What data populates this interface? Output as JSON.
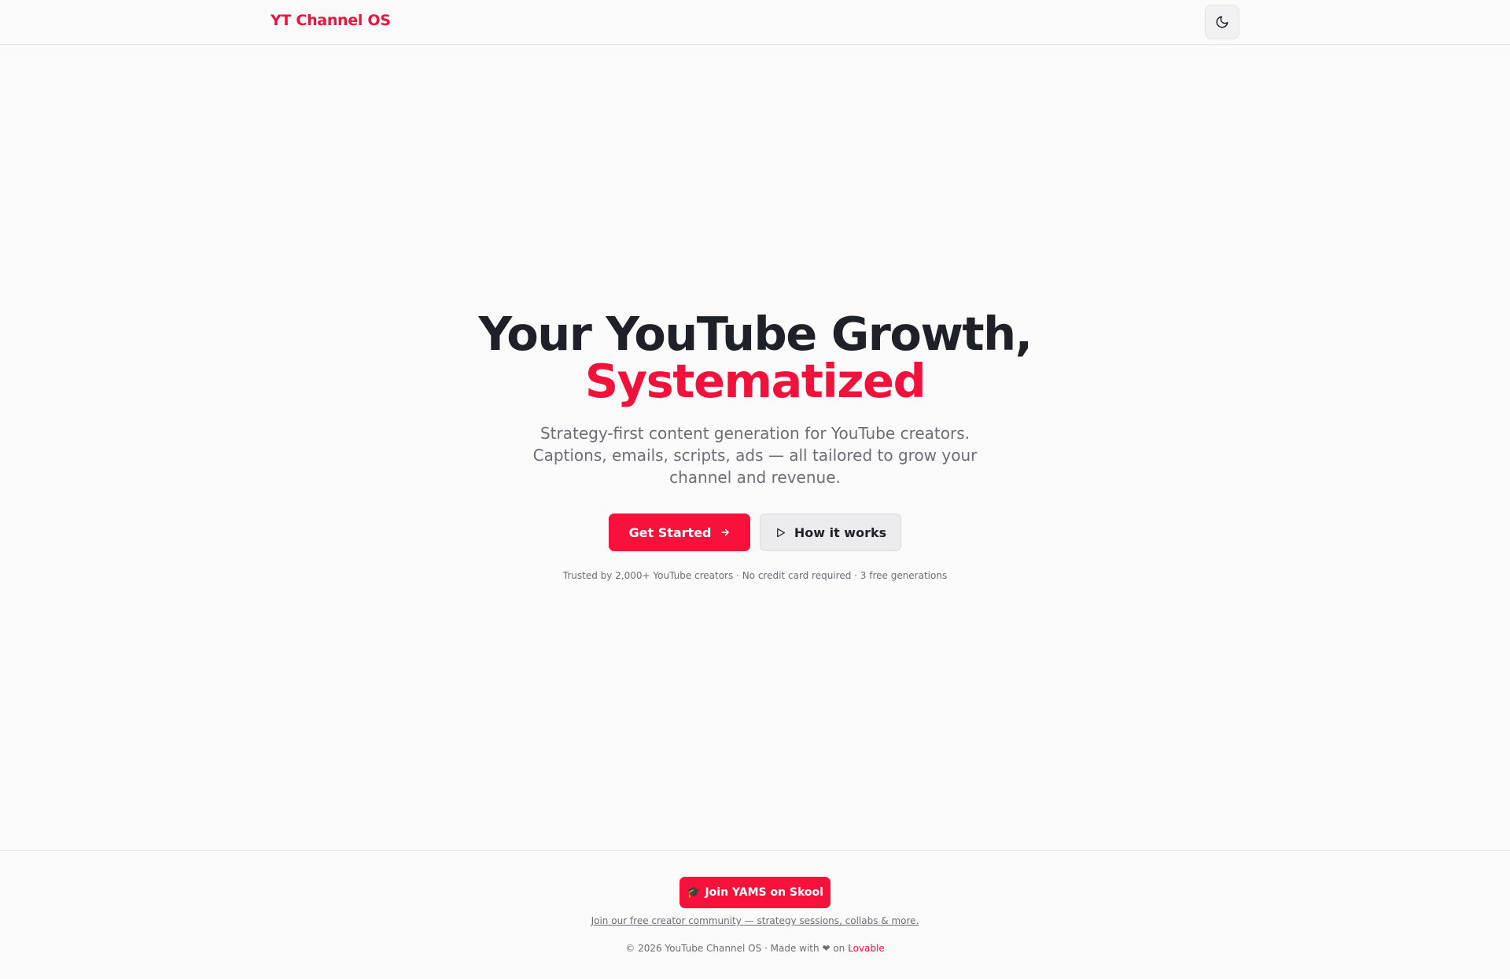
{
  "header": {
    "logo": "YT Channel OS",
    "theme_toggle_icon": "moon-icon"
  },
  "hero": {
    "title_line1": "Your YouTube Growth,",
    "title_line2": "Systematized",
    "subtitle": "Strategy-first content generation for YouTube creators. Captions, emails, scripts, ads — all tailored to grow your channel and revenue.",
    "primary_button": "Get Started",
    "primary_button_icon": "arrow-right-icon",
    "secondary_button": "How it works",
    "secondary_button_icon": "play-icon",
    "trust_line": "Trusted by 2,000+ YouTube creators · No credit card required · 3 free generations"
  },
  "footer": {
    "skool_button_emoji": "🎓",
    "skool_button": "Join YAMS on Skool",
    "community_link": "Join our free creator community — strategy sessions, collabs & more.",
    "copyright_prefix": "© 2026 YouTube Channel OS · Made with",
    "heart": "❤",
    "on": "on",
    "lovable": "Lovable"
  },
  "colors": {
    "accent": "#f0123a",
    "text": "#1f2128",
    "muted": "#6b6e78",
    "background": "#fafafa"
  }
}
